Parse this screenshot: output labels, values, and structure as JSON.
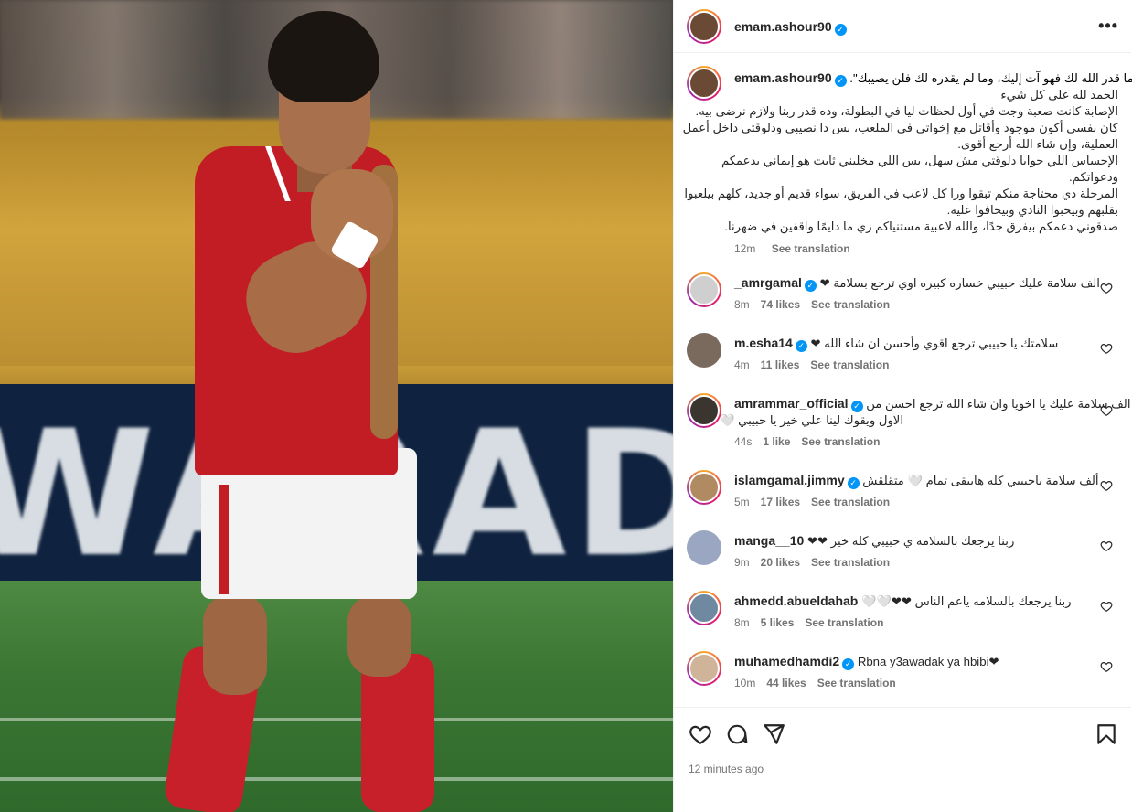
{
  "post": {
    "username": "emam.ashour90",
    "verified": true
  },
  "caption": {
    "username": "emam.ashour90",
    "line1": "\"ما قدر الله لك فهو آت إليك، وما لم يقدره لك فلن يصيبك\".",
    "lines": [
      "الحمد لله على كل شيء",
      "الإصابة كانت صعبة وجت في أول لحظات ليا في البطولة، وده قدر ربنا ولازم نرضى بيه.",
      "كان نفسي أكون موجود وأقاتل مع إخواتي في الملعب، بس دا نصيبي ودلوقتي داخل أعمل",
      "العملية، وإن شاء الله أرجع أقوى.",
      "الإحساس اللي جوايا دلوقتي مش سهل، بس اللي مخليني ثابت هو إيماني بدعمكم",
      "ودعواتكم.",
      "المرحلة دي محتاجة منكم تبقوا ورا كل لاعب في الفريق، سواء قديم أو جديد، كلهم بيلعبوا",
      "بقلبهم وبيحبوا النادي وبيخافوا عليه.",
      "صدقوني دعمكم بيفرق جدًا، والله لاعبية مستنياكم زي ما دايمًا واقفين في ضهرنا."
    ],
    "time": "12m",
    "see_translation": "See translation"
  },
  "comments": [
    {
      "username": "_amrgamal",
      "verified": true,
      "text": "الف سلامة عليك حبيبي خساره كبيره اوي ترجع بسلامة ❤",
      "text2": "",
      "time": "8m",
      "likes": "74 likes",
      "see_translation": "See translation",
      "avatar_color": "#cfcfcf"
    },
    {
      "username": "m.esha14",
      "verified": true,
      "text": "سلامتك يا حبيبي ترجع اقوي وأحسن ان شاء الله ❤",
      "text2": "",
      "time": "4m",
      "likes": "11 likes",
      "see_translation": "See translation",
      "avatar_color": "#7a6a5e"
    },
    {
      "username": "amrammar_official",
      "verified": true,
      "text": "الف سلامة عليك يا اخويا وان شاء الله ترجع احسن من",
      "text2": "الاول ويقوك لينا علي خير يا حبيبي 🤍",
      "time": "44s",
      "likes": "1 like",
      "see_translation": "See translation",
      "avatar_color": "#3b3530"
    },
    {
      "username": "islamgamal.jimmy",
      "verified": true,
      "text": "ألف سلامة ياحبيبي كله هايبقى تمام 🤍 متقلقش",
      "text2": "",
      "time": "5m",
      "likes": "17 likes",
      "see_translation": "See translation",
      "avatar_color": "#b08a60"
    },
    {
      "username": "manga__10",
      "verified": false,
      "text": "ربنا يرجعك بالسلامه ي حبيبي كله خير ❤❤",
      "text2": "",
      "time": "9m",
      "likes": "20 likes",
      "see_translation": "See translation",
      "avatar_color": "#9aa6c2"
    },
    {
      "username": "ahmedd.abueldahab",
      "verified": false,
      "text": "ربنا يرجعك بالسلامه ياعم الناس ❤❤🤍🤍",
      "text2": "",
      "time": "8m",
      "likes": "5 likes",
      "see_translation": "See translation",
      "avatar_color": "#6f8aa0"
    },
    {
      "username": "muhamedhamdi2",
      "verified": true,
      "text": "Rbna y3awadak ya hbibi❤",
      "text2": "",
      "time": "10m",
      "likes": "44 likes",
      "see_translation": "See translation",
      "avatar_color": "#d0b49a"
    }
  ],
  "footer": {
    "time_ago": "12 minutes ago"
  },
  "photo": {
    "board_text": "WARAD"
  },
  "icons": {
    "like": "heart-icon",
    "comment": "comment-icon",
    "share": "share-icon",
    "save": "bookmark-icon",
    "more": "more-icon"
  }
}
